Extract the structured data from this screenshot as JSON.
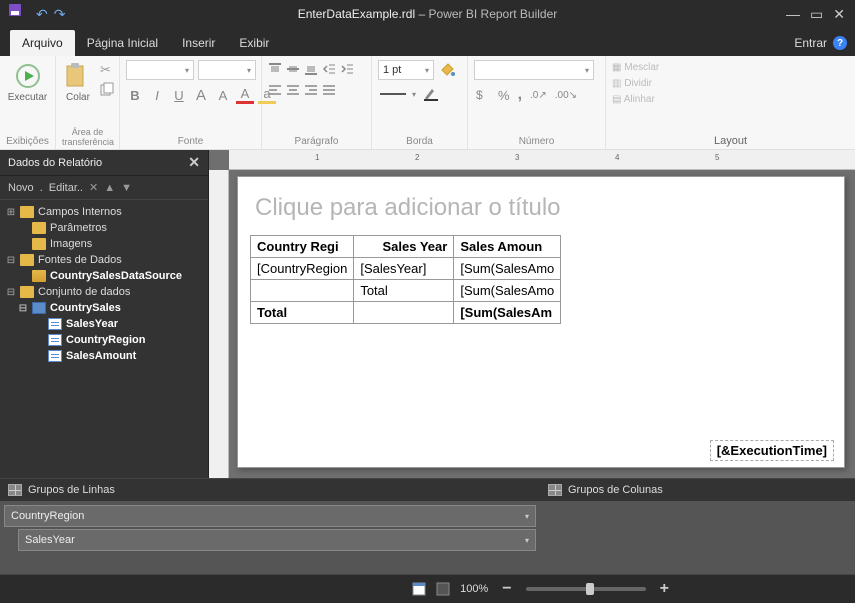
{
  "titlebar": {
    "filename": "EnterDataExample.rdl",
    "sep": "–",
    "appname": "Power BI Report Builder"
  },
  "tabs": {
    "arquivo": "Arquivo",
    "pagina_inicial": "Página Inicial",
    "inserir": "Inserir",
    "exibir": "Exibir",
    "entrar": "Entrar"
  },
  "ribbon": {
    "executar": "Executar",
    "colar": "Colar",
    "exibicoes": "Exibições",
    "area_transferencia": "Área de transferência",
    "fonte": "Fonte",
    "paragrafo": "Parágrafo",
    "borda": "Borda",
    "numero": "Número",
    "layout": "Layout",
    "border_width": "1 pt",
    "mesclar": "Mesclar",
    "dividir": "Dividir",
    "alinhar": "Alinhar",
    "bold": "B",
    "italic": "I",
    "underline": "U",
    "a_upper": "A",
    "a_lower": "a"
  },
  "left": {
    "title": "Dados do Relatório",
    "novo": "Novo",
    "editar": "Editar..",
    "campos_internos": "Campos Internos",
    "parametros": "Parâmetros",
    "imagens": "Imagens",
    "fontes_dados": "Fontes de Dados",
    "datasource": "CountrySalesDataSource",
    "conjunto_dados": "Conjunto de dados",
    "dataset": "CountrySales",
    "f1": "SalesYear",
    "f2": "CountryRegion",
    "f3": "SalesAmount"
  },
  "canvas": {
    "title_placeholder": "Clique para adicionar o título",
    "h1": "Country Regi",
    "h2": "Sales Year",
    "h3": "Sales Amoun",
    "r1c1": "[CountryRegion",
    "r1c2": "[SalesYear]",
    "r1c3": "[Sum(SalesAmo",
    "r2c2": "Total",
    "r2c3": "[Sum(SalesAmo",
    "r3c1": "Total",
    "r3c3": "[Sum(SalesAm",
    "exectime": "[&ExecutionTime]"
  },
  "groups": {
    "linhas": "Grupos de Linhas",
    "colunas": "Grupos de Colunas",
    "g1": "CountryRegion",
    "g2": "SalesYear"
  },
  "status": {
    "zoom": "100%"
  },
  "ruler": {
    "n1": "1",
    "n2": "2",
    "n3": "3",
    "n4": "4",
    "n5": "5"
  }
}
